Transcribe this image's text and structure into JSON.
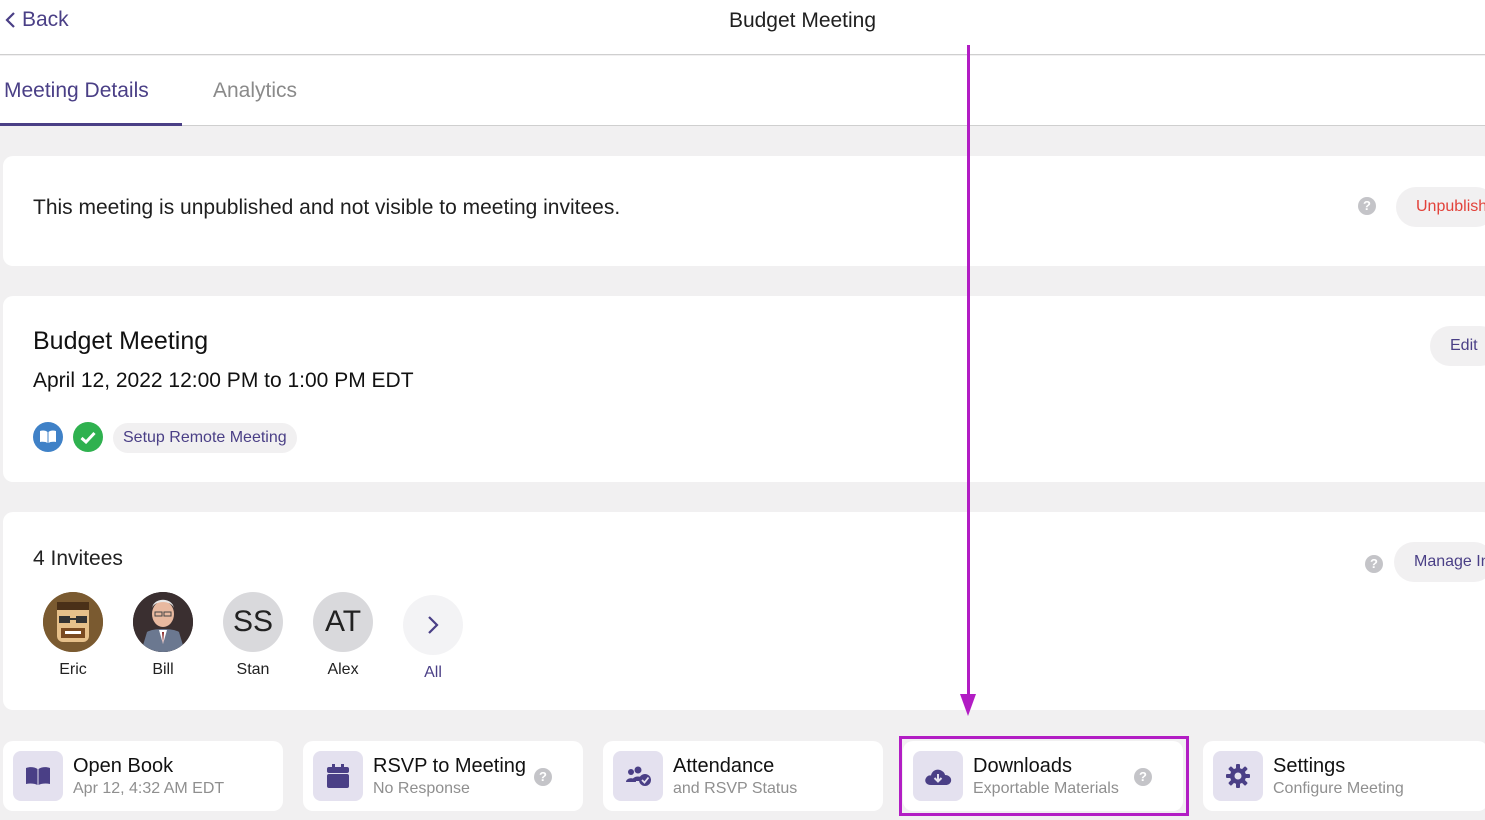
{
  "header": {
    "back_label": "Back",
    "title": "Budget Meeting"
  },
  "tabs": [
    {
      "label": "Meeting Details",
      "active": true
    },
    {
      "label": "Analytics",
      "active": false
    }
  ],
  "publish_card": {
    "message": "This meeting is unpublished and not visible to meeting invitees.",
    "button_label": "Unpublish"
  },
  "meeting_card": {
    "title": "Budget Meeting",
    "date": "April 12, 2022 12:00 PM to 1:00 PM EDT",
    "edit_label": "Edit",
    "setup_remote_label": "Setup Remote Meeting"
  },
  "invitees_card": {
    "count_label": "4 Invitees",
    "manage_label": "Manage Invitees",
    "invitees": [
      {
        "name": "Eric",
        "initials": ""
      },
      {
        "name": "Bill",
        "initials": ""
      },
      {
        "name": "Stan",
        "initials": "SS"
      },
      {
        "name": "Alex",
        "initials": "AT"
      }
    ],
    "all_label": "All"
  },
  "tiles": [
    {
      "title": "Open Book",
      "subtitle": "Apr 12, 4:32 AM EDT",
      "icon": "book-icon"
    },
    {
      "title": "RSVP to Meeting",
      "subtitle": "No Response",
      "icon": "calendar-icon"
    },
    {
      "title": "Attendance",
      "subtitle": "and RSVP Status",
      "icon": "users-check-icon"
    },
    {
      "title": "Downloads",
      "subtitle": "Exportable Materials",
      "icon": "cloud-download-icon"
    },
    {
      "title": "Settings",
      "subtitle": "Configure Meeting",
      "icon": "gear-icon"
    }
  ],
  "help_glyph": "?",
  "colors": {
    "accent": "#4a3f86",
    "danger": "#e2423a",
    "annotation": "#b21dc4",
    "book_blue": "#3f81c7",
    "check_green": "#2fb14f"
  }
}
